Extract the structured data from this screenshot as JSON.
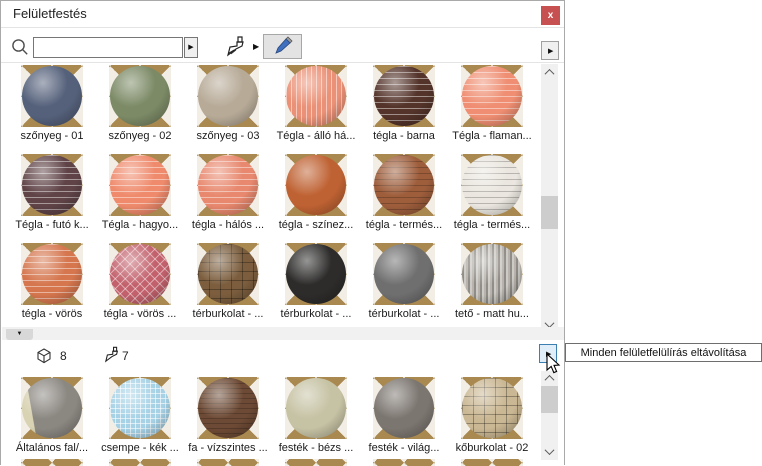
{
  "window": {
    "title": "Felületfestés",
    "close_label": "x"
  },
  "toolbar": {
    "search_value": "",
    "search_placeholder": "",
    "search_dropdown_glyph": "▶",
    "brush_caret_glyph": "▶",
    "panel_arrow_glyph": "▶"
  },
  "icons": {
    "search": "magnifier-icon",
    "brush": "paintbrush-icon",
    "eyedropper": "eyedropper-icon",
    "cube": "object-cube-icon",
    "close": "close-icon",
    "collapse": "collapse-triangle-icon"
  },
  "upper_pane": {
    "items": [
      {
        "label": "szőnyeg - 01",
        "color": "#55617b",
        "pattern": "none"
      },
      {
        "label": "szőnyeg - 02",
        "color": "#7c8a66",
        "pattern": "none"
      },
      {
        "label": "szőnyeg - 03",
        "color": "#b7aa97",
        "pattern": "none"
      },
      {
        "label": "Tégla - álló há...",
        "color": "#eb9177",
        "pattern": "vbrick"
      },
      {
        "label": "tégla - barna",
        "color": "#53332a",
        "pattern": "brick"
      },
      {
        "label": "Tégla - flaman...",
        "color": "#ef8e72",
        "pattern": "brick"
      },
      {
        "label": "Tégla - futó k...",
        "color": "#5f4347",
        "pattern": "brick"
      },
      {
        "label": "Tégla - hagyo...",
        "color": "#ef8a6c",
        "pattern": "brick"
      },
      {
        "label": "tégla - hálós ...",
        "color": "#e8886e",
        "pattern": "brick"
      },
      {
        "label": "tégla - színez...",
        "color": "#bf6233",
        "pattern": "none"
      },
      {
        "label": "tégla - termés...",
        "color": "#9e5e3c",
        "pattern": "brickdark"
      },
      {
        "label": "tégla - termés...",
        "color": "#ebe7e0",
        "pattern": "brickdark"
      },
      {
        "label": "tégla - vörös",
        "color": "#d5764e",
        "pattern": "brick"
      },
      {
        "label": "tégla - vörös ...",
        "color": "#c2616c",
        "pattern": "herringbone"
      },
      {
        "label": "térburkolat - ...",
        "color": "#7c5e3e",
        "pattern": "stone"
      },
      {
        "label": "térburkolat - ...",
        "color": "#2d2c2b",
        "pattern": "none"
      },
      {
        "label": "térburkolat - ...",
        "color": "#6f6f6f",
        "pattern": "none"
      },
      {
        "label": "tető - matt hu...",
        "color": "#b8b4ad",
        "pattern": "ridged"
      }
    ]
  },
  "divider": {
    "collapse_glyph": "▼",
    "object_count": "8",
    "override_count": "7"
  },
  "lower_pane": {
    "items": [
      {
        "label": "Általános fal/...",
        "color": "#8b8781",
        "pattern": "split",
        "color2": "#d9d3b4"
      },
      {
        "label": "csempe - kék ...",
        "color": "#a7d2e6",
        "pattern": "mosaic"
      },
      {
        "label": "fa - vízszintes ...",
        "color": "#6d4a35",
        "pattern": "wood"
      },
      {
        "label": "festék - bézs ...",
        "color": "#c6c2a4",
        "pattern": "none"
      },
      {
        "label": "festék - világ...",
        "color": "#7c7670",
        "pattern": "none"
      },
      {
        "label": "kőburkolat - 02",
        "color": "#cab793",
        "pattern": "stone"
      }
    ],
    "partial_next_count": 6
  },
  "tooltip": {
    "text": "Minden felületfelülírás eltávolítása"
  },
  "colors": {
    "close_red": "#c75050",
    "checker_tan": "#a9894f",
    "checker_light": "#f2eee6",
    "hover_border_blue": "#3c7fb1",
    "hover_fill_blue": "#e0eef9",
    "scroll_track": "#f0f0f0",
    "scroll_thumb": "#cdcdcd",
    "eyedropper_blue": "#3f6fbe"
  }
}
